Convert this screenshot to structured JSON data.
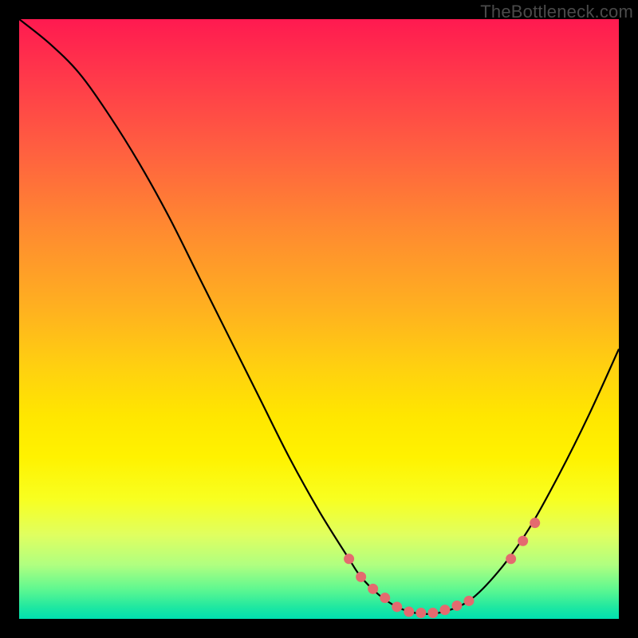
{
  "watermark": "TheBottleneck.com",
  "chart_data": {
    "type": "line",
    "title": "",
    "xlabel": "",
    "ylabel": "",
    "xlim": [
      0,
      100
    ],
    "ylim": [
      0,
      100
    ],
    "grid": false,
    "legend": false,
    "series": [
      {
        "name": "bottleneck-curve",
        "x": [
          0,
          5,
          10,
          15,
          20,
          25,
          30,
          35,
          40,
          45,
          50,
          55,
          57,
          60,
          63,
          66,
          70,
          75,
          80,
          85,
          90,
          95,
          100
        ],
        "y": [
          100,
          96,
          91,
          84,
          76,
          67,
          57,
          47,
          37,
          27,
          18,
          10,
          7,
          4,
          2,
          1,
          1,
          3,
          8,
          15,
          24,
          34,
          45
        ]
      }
    ],
    "markers": {
      "name": "highlight-dots",
      "color": "#e46a6f",
      "x": [
        55,
        57,
        59,
        61,
        63,
        65,
        67,
        69,
        71,
        73,
        75,
        82,
        84,
        86
      ],
      "y": [
        10,
        7,
        5,
        3.5,
        2,
        1.2,
        1,
        1,
        1.5,
        2.2,
        3,
        10,
        13,
        16
      ]
    },
    "gradient": {
      "top_color": "#ff1a50",
      "bottom_color": "#00e0b0"
    }
  }
}
